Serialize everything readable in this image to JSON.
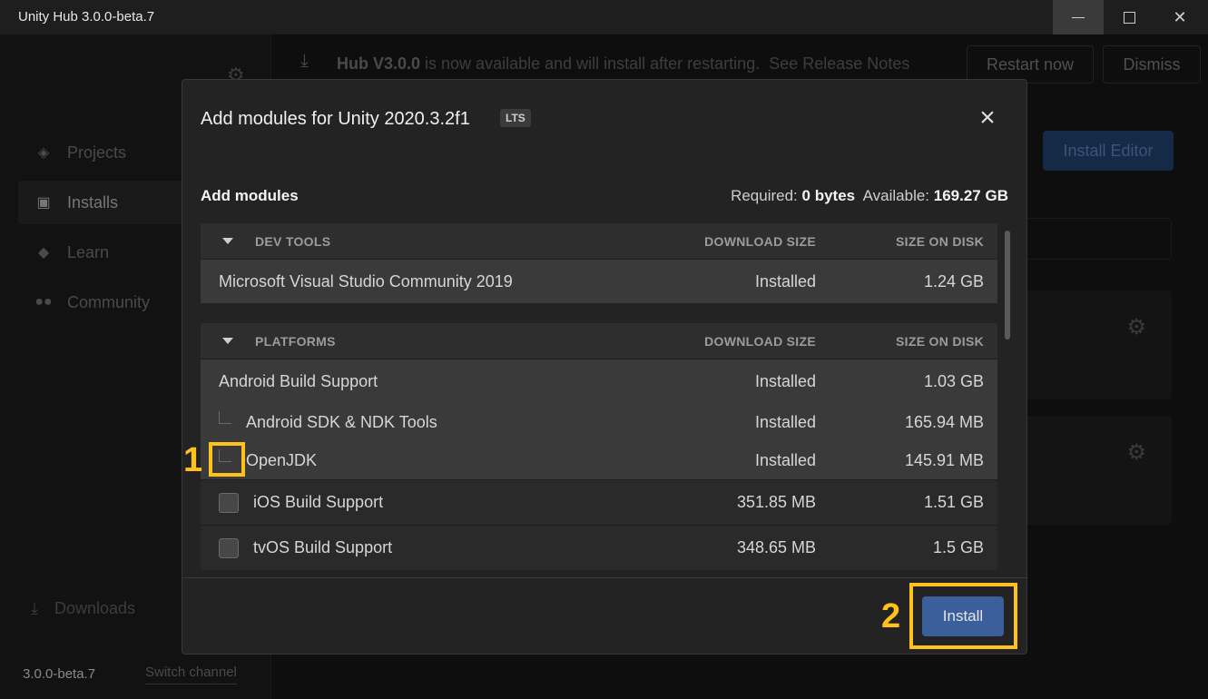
{
  "window": {
    "title": "Unity Hub 3.0.0-beta.7"
  },
  "sidebar": {
    "items": [
      {
        "label": "Projects",
        "icon": "cube-icon"
      },
      {
        "label": "Installs",
        "icon": "lock-icon"
      },
      {
        "label": "Learn",
        "icon": "graduation-cap-icon"
      },
      {
        "label": "Community",
        "icon": "people-icon"
      }
    ],
    "downloads_label": "Downloads",
    "version": "3.0.0-beta.7",
    "switch_channel": "Switch channel"
  },
  "banner": {
    "version": "Hub V3.0.0",
    "message": " is now available and will install after restarting.",
    "release_notes": "See Release Notes",
    "restart_label": "Restart now",
    "dismiss_label": "Dismiss"
  },
  "main": {
    "install_editor_label": "Install Editor"
  },
  "modal": {
    "title": "Add modules for Unity 2020.3.2f1",
    "badge": "LTS",
    "subtitle": "Add modules",
    "required_label": "Required:",
    "required_value": "0 bytes",
    "available_label": "Available:",
    "available_value": "169.27 GB",
    "install_label": "Install",
    "sections": {
      "dev_tools": {
        "title": "DEV TOOLS",
        "col_download": "DOWNLOAD SIZE",
        "col_disk": "SIZE ON DISK",
        "rows": [
          {
            "name": "Microsoft Visual Studio Community 2019",
            "download": "Installed",
            "disk": "1.24 GB"
          }
        ]
      },
      "platforms": {
        "title": "PLATFORMS",
        "col_download": "DOWNLOAD SIZE",
        "col_disk": "SIZE ON DISK",
        "rows": [
          {
            "name": "Android Build Support",
            "download": "Installed",
            "disk": "1.03 GB"
          },
          {
            "name": "Android SDK & NDK Tools",
            "download": "Installed",
            "disk": "165.94 MB"
          },
          {
            "name": "OpenJDK",
            "download": "Installed",
            "disk": "145.91 MB"
          },
          {
            "name": "iOS Build Support",
            "download": "351.85 MB",
            "disk": "1.51 GB"
          },
          {
            "name": "tvOS Build Support",
            "download": "348.65 MB",
            "disk": "1.5 GB"
          }
        ]
      }
    }
  },
  "annotations": {
    "one": "1",
    "two": "2",
    "color": "#ffc21a"
  }
}
